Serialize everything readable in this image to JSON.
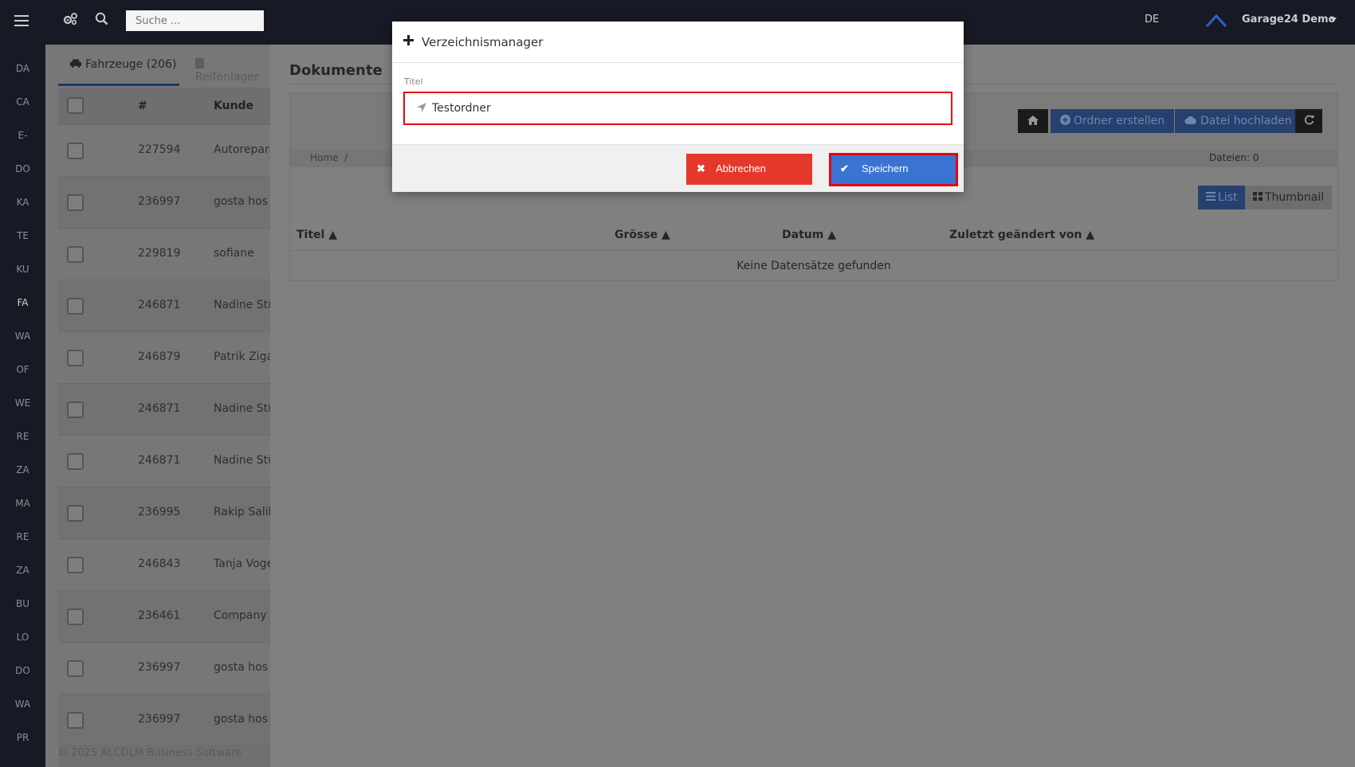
{
  "topbar": {
    "search_placeholder": "Suche ...",
    "lang": "DE",
    "user": "Garage24 Demo"
  },
  "sidebar": {
    "items": [
      "DA",
      "CA",
      "E-",
      "DO",
      "KA",
      "TE",
      "KU",
      "FA",
      "WA",
      "OF",
      "WE",
      "RE",
      "ZA",
      "MA",
      "RE",
      "ZA",
      "BU",
      "LO",
      "DO",
      "WA",
      "PR"
    ],
    "active_index": 7
  },
  "left_panel": {
    "tab_vehicles": "Fahrzeuge (206)",
    "tab_tires": "Reifenlager",
    "col_hash": "#",
    "col_kunde": "Kunde",
    "rows": [
      {
        "num": "227594",
        "kunde": "Autorepara"
      },
      {
        "num": "236997",
        "kunde": "gosta hos"
      },
      {
        "num": "229819",
        "kunde": "sofiane"
      },
      {
        "num": "246871",
        "kunde": "Nadine Stü"
      },
      {
        "num": "246879",
        "kunde": "Patrik Ziga"
      },
      {
        "num": "246871",
        "kunde": "Nadine Stü"
      },
      {
        "num": "246871",
        "kunde": "Nadine Stü"
      },
      {
        "num": "236995",
        "kunde": "Rakip Salih"
      },
      {
        "num": "246843",
        "kunde": "Tanja Voge"
      },
      {
        "num": "236461",
        "kunde": "Company"
      },
      {
        "num": "236997",
        "kunde": "gosta hos"
      },
      {
        "num": "236997",
        "kunde": "gosta hos"
      }
    ],
    "footer": "© 2025 ALCOLM Business Software"
  },
  "documents": {
    "title": "Dokumente",
    "btn_create_folder": "Ordner erstellen",
    "btn_upload": "Datei hochladen",
    "breadcrumb_home": "Home",
    "breadcrumb_sep": "/",
    "files_count": "Dateien: 0",
    "view_list": "List",
    "view_thumbnail": "Thumbnail",
    "columns": [
      "Titel ▲",
      "Grösse ▲",
      "Datum ▲",
      "Zuletzt geändert von ▲"
    ],
    "empty_message": "Keine Datensätze gefunden"
  },
  "modal": {
    "title": "Verzeichnismanager",
    "field_label": "Titel",
    "field_value": "Testordner",
    "cancel_label": "Abbrechen",
    "save_label": "Speichern"
  },
  "colors": {
    "topbar_bg": "#171a24",
    "danger": "#e5372b",
    "primary": "#3a73d1",
    "highlight_border": "#e30613"
  }
}
